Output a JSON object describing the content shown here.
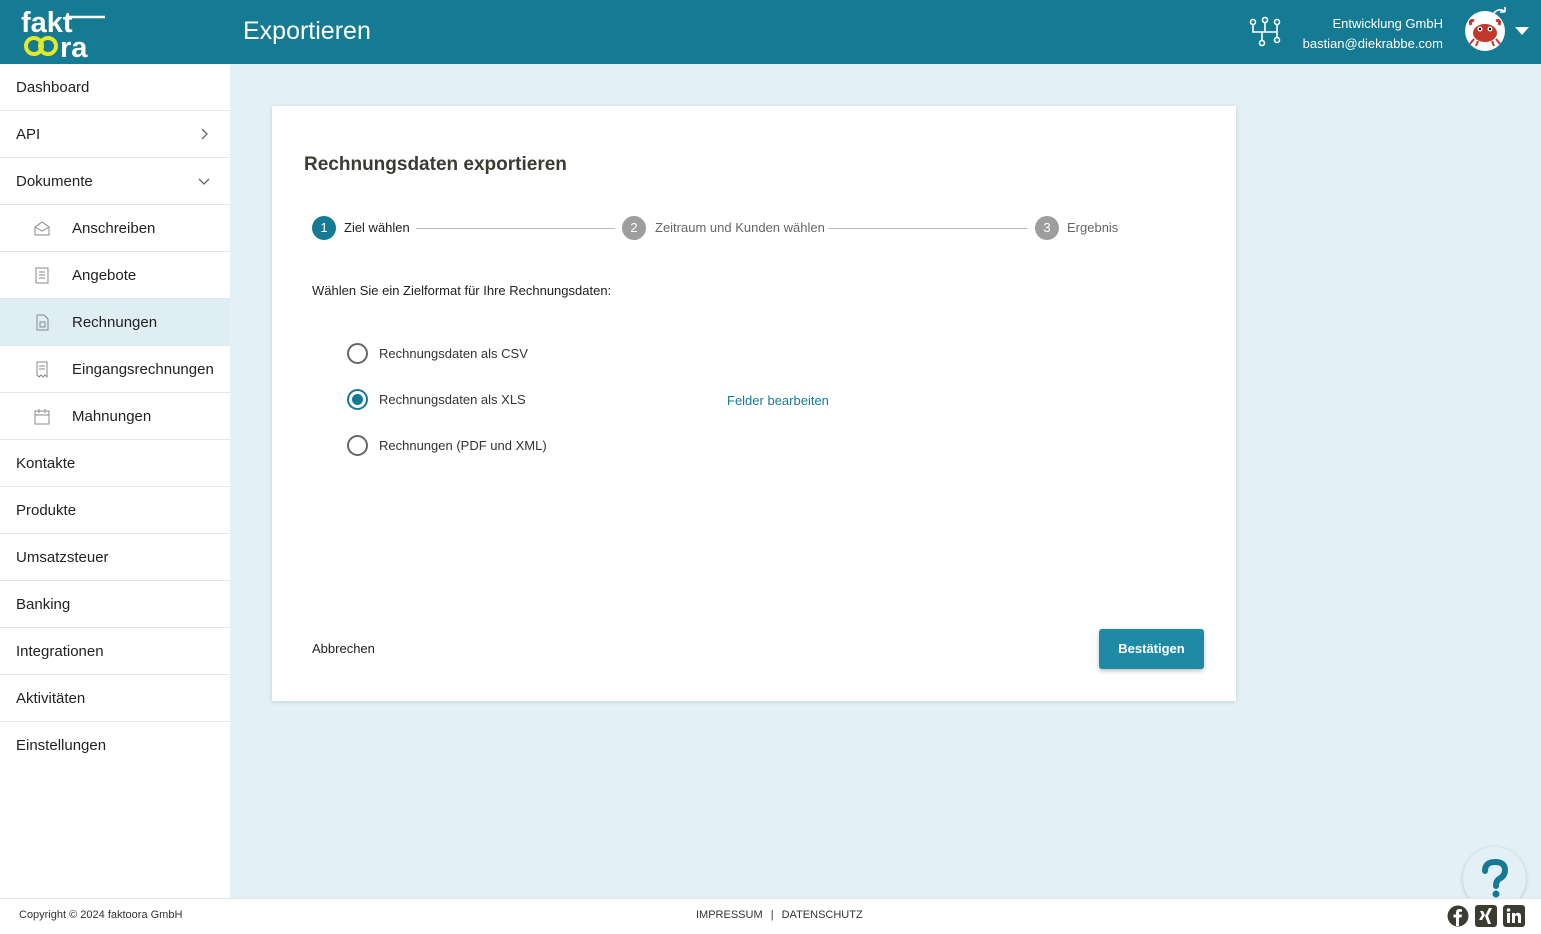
{
  "header": {
    "title": "Exportieren",
    "company": "Entwicklung GmbH",
    "email": "bastian@diekrabbe.com",
    "logo_text_top": "fakt",
    "logo_text_bottom": "ra"
  },
  "sidebar": {
    "items": [
      {
        "label": "Dashboard"
      },
      {
        "label": "API"
      },
      {
        "label": "Dokumente"
      },
      {
        "label": "Anschreiben"
      },
      {
        "label": "Angebote"
      },
      {
        "label": "Rechnungen"
      },
      {
        "label": "Eingangsrechnungen"
      },
      {
        "label": "Mahnungen"
      },
      {
        "label": "Kontakte"
      },
      {
        "label": "Produkte"
      },
      {
        "label": "Umsatzsteuer"
      },
      {
        "label": "Banking"
      },
      {
        "label": "Integrationen"
      },
      {
        "label": "Aktivitäten"
      },
      {
        "label": "Einstellungen"
      }
    ]
  },
  "card": {
    "title": "Rechnungsdaten exportieren",
    "steps": [
      {
        "number": "1",
        "label": "Ziel wählen"
      },
      {
        "number": "2",
        "label": "Zeitraum und Kunden wählen"
      },
      {
        "number": "3",
        "label": "Ergebnis"
      }
    ],
    "prompt": "Wählen Sie ein Zielformat für Ihre Rechnungsdaten:",
    "options": [
      {
        "label": "Rechnungsdaten als CSV",
        "checked": false
      },
      {
        "label": "Rechnungsdaten als XLS",
        "checked": true
      },
      {
        "label": "Rechnungen (PDF und XML)",
        "checked": false
      }
    ],
    "edit_fields_link": "Felder bearbeiten",
    "cancel_label": "Abbrechen",
    "confirm_label": "Bestätigen"
  },
  "footer": {
    "copyright": "Copyright © 2024 faktoora GmbH",
    "impressum": "IMPRESSUM",
    "separator": "|",
    "datenschutz": "DATENSCHUTZ"
  },
  "colors": {
    "brand": "#157a93",
    "accent_yellow": "#e2e82a",
    "background": "#e3f0f6",
    "button": "#1e8aa6"
  },
  "icons": [
    "network-icon",
    "avatar",
    "help-icon",
    "facebook-icon",
    "xing-icon",
    "linkedin-icon"
  ]
}
